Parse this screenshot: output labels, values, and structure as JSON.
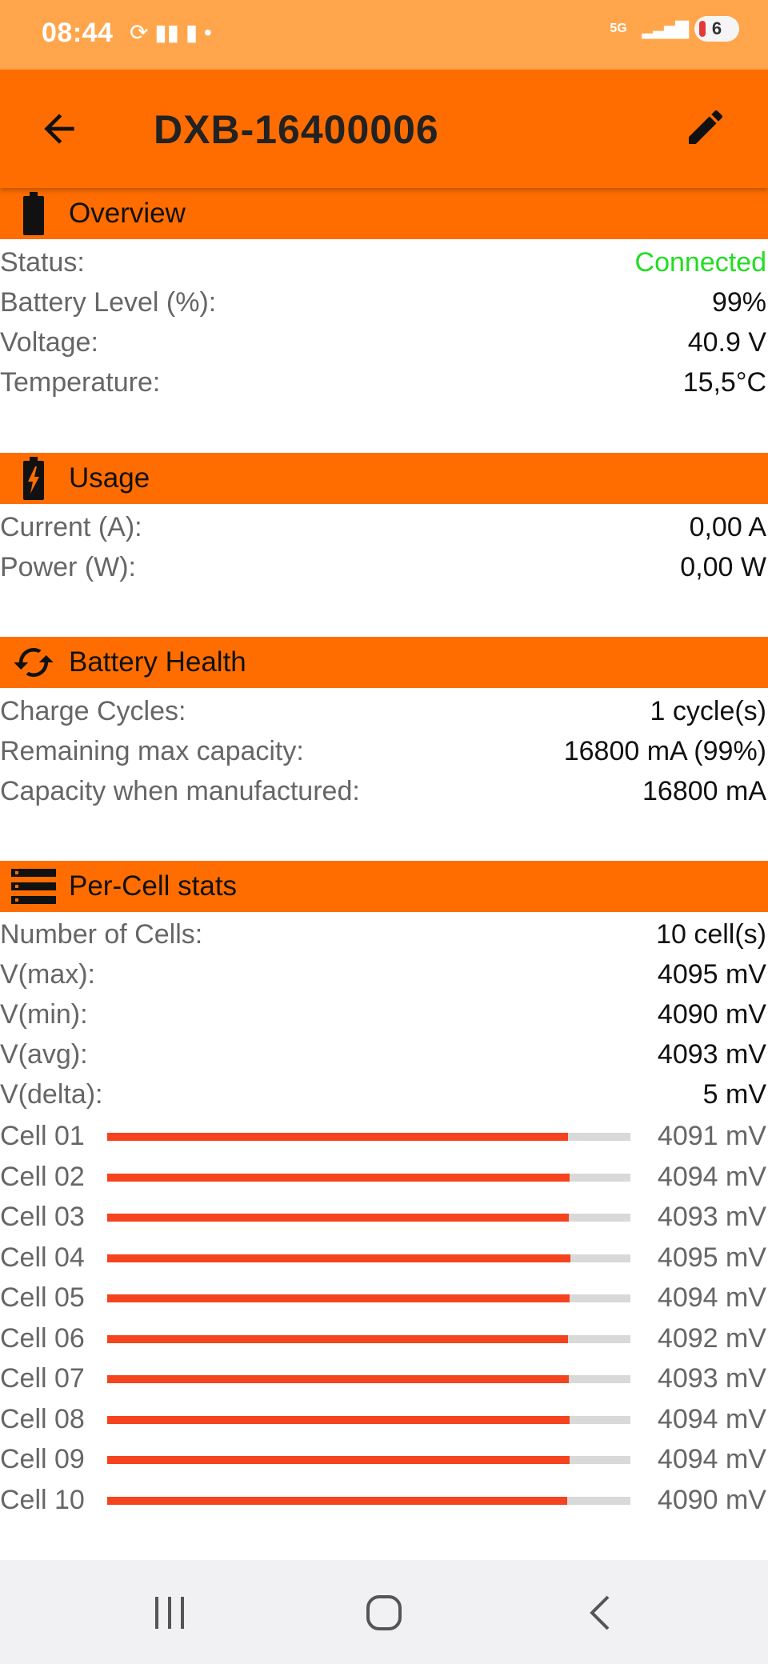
{
  "status_bar": {
    "time": "08:44",
    "notif_icons": "⟳ ▮▮ ▮ •",
    "network": "5G",
    "battery": "6"
  },
  "app_bar": {
    "title": "DXB-16400006",
    "back_icon": "arrow-left-icon",
    "edit_icon": "pencil-icon"
  },
  "overview": {
    "title": "Overview",
    "icon": "battery-icon",
    "rows": [
      {
        "label": "Status:",
        "value": "Connected",
        "color": "#22DD22"
      },
      {
        "label": "Battery Level (%):",
        "value": "99%"
      },
      {
        "label": "Voltage:",
        "value": "40.9 V"
      },
      {
        "label": "Temperature:",
        "value": "15,5°C"
      }
    ]
  },
  "usage": {
    "title": "Usage",
    "icon": "battery-charging-icon",
    "rows": [
      {
        "label": "Current (A):",
        "value": "0,00 A"
      },
      {
        "label": "Power (W):",
        "value": "0,00 W"
      }
    ]
  },
  "health": {
    "title": "Battery Health",
    "icon": "sync-icon",
    "rows": [
      {
        "label": "Charge Cycles:",
        "value": "1 cycle(s)"
      },
      {
        "label": "Remaining max capacity:",
        "value": "16800 mA (99%)"
      },
      {
        "label": "Capacity when manufactured:",
        "value": "16800 mA"
      }
    ]
  },
  "per_cell": {
    "title": "Per-Cell stats",
    "icon": "list-icon",
    "rows": [
      {
        "label": "Number of Cells:",
        "value": "10 cell(s)"
      },
      {
        "label": "V(max):",
        "value": "4095 mV"
      },
      {
        "label": "V(min):",
        "value": "4090 mV"
      },
      {
        "label": "V(avg):",
        "value": "4093 mV"
      },
      {
        "label": "V(delta):",
        "value": "5 mV"
      }
    ],
    "cells": [
      {
        "label": "Cell 01",
        "value": "4091 mV",
        "level": 0.88
      },
      {
        "label": "Cell 02",
        "value": "4094 mV",
        "level": 0.884
      },
      {
        "label": "Cell 03",
        "value": "4093 mV",
        "level": 0.882
      },
      {
        "label": "Cell 04",
        "value": "4095 mV",
        "level": 0.885
      },
      {
        "label": "Cell 05",
        "value": "4094 mV",
        "level": 0.884
      },
      {
        "label": "Cell 06",
        "value": "4092 mV",
        "level": 0.881
      },
      {
        "label": "Cell 07",
        "value": "4093 mV",
        "level": 0.882
      },
      {
        "label": "Cell 08",
        "value": "4094 mV",
        "level": 0.884
      },
      {
        "label": "Cell 09",
        "value": "4094 mV",
        "level": 0.884
      },
      {
        "label": "Cell 10",
        "value": "4090 mV",
        "level": 0.879
      }
    ]
  },
  "nav_bar": {
    "recents": "recents-icon",
    "home": "home-icon",
    "back": "back-icon"
  },
  "colors": {
    "accent": "#FF6D00",
    "status_bar": "#FFA64D",
    "bar_fill": "#F4431E",
    "bar_track": "#D9D9D9"
  }
}
